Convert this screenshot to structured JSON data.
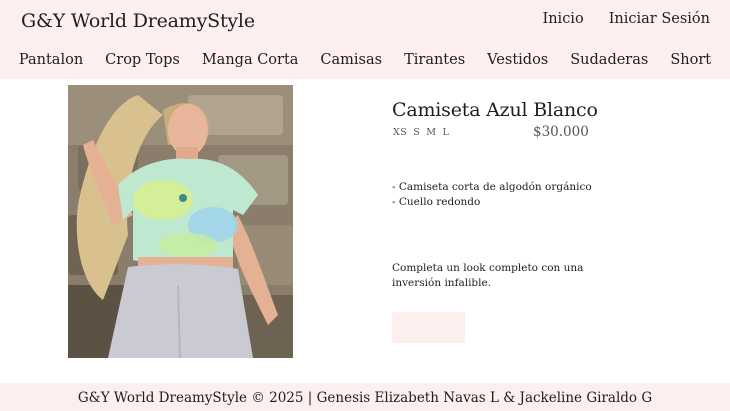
{
  "header": {
    "brand": "G&Y World DreamyStyle",
    "links": [
      "Inicio",
      "Iniciar Sesión"
    ]
  },
  "nav": {
    "categories": [
      "Pantalon",
      "Crop Tops",
      "Manga Corta",
      "Camisas",
      "Tirantes",
      "Vestidos",
      "Sudaderas",
      "Short"
    ]
  },
  "product": {
    "title": "Camiseta Azul Blanco",
    "sizes": [
      "XS",
      "S",
      "M",
      "L"
    ],
    "price": "$30.000",
    "features": [
      "- Camiseta corta de algodón orgánico",
      "- Cuello redondo"
    ],
    "description": "Completa un look completo con una inversión infalible.",
    "button_label": ""
  },
  "footer": {
    "text": "G&Y World DreamyStyle © 2025 | Genesis Elizabeth Navas L & Jackeline Giraldo G"
  },
  "colors": {
    "header_bg": "#fcefed",
    "button_bg": "#fcefed",
    "text": "#1e1e1e"
  }
}
